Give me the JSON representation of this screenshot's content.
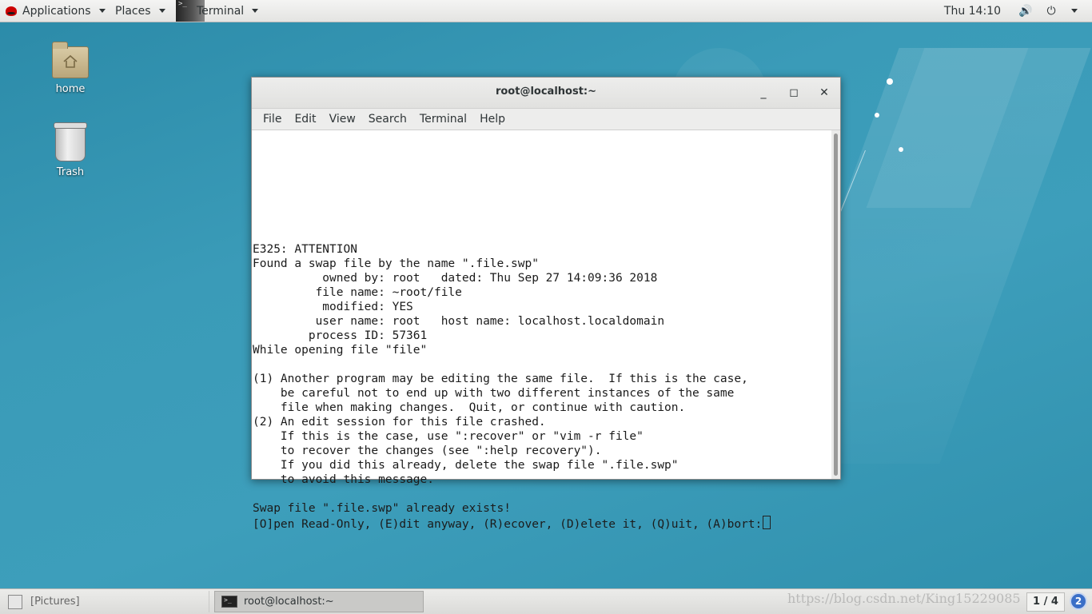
{
  "topbar": {
    "applications": "Applications",
    "places": "Places",
    "terminal_app": "Terminal",
    "clock": "Thu 14:10",
    "volume_icon": "volume-icon",
    "power_icon": "power-icon"
  },
  "desktop": {
    "icons": [
      {
        "label": "home",
        "icon": "folder-home-icon"
      },
      {
        "label": "Trash",
        "icon": "trash-icon"
      }
    ]
  },
  "window": {
    "title": "root@localhost:~",
    "menu": [
      "File",
      "Edit",
      "View",
      "Search",
      "Terminal",
      "Help"
    ],
    "terminal_lines": [
      "E325: ATTENTION",
      "Found a swap file by the name \".file.swp\"",
      "          owned by: root   dated: Thu Sep 27 14:09:36 2018",
      "         file name: ~root/file",
      "          modified: YES",
      "         user name: root   host name: localhost.localdomain",
      "        process ID: 57361",
      "While opening file \"file\"",
      "",
      "(1) Another program may be editing the same file.  If this is the case,",
      "    be careful not to end up with two different instances of the same",
      "    file when making changes.  Quit, or continue with caution.",
      "(2) An edit session for this file crashed.",
      "    If this is the case, use \":recover\" or \"vim -r file\"",
      "    to recover the changes (see \":help recovery\").",
      "    If you did this already, delete the swap file \".file.swp\"",
      "    to avoid this message.",
      "",
      "Swap file \".file.swp\" already exists!"
    ],
    "prompt_line": "[O]pen Read-Only, (E)dit anyway, (R)ecover, (D)elete it, (Q)uit, (A)bort:"
  },
  "taskbar": {
    "pictures": "[Pictures]",
    "terminal_task": "root@localhost:~",
    "watermark": "https://blog.csdn.net/King15229085",
    "workspace": "1 / 4",
    "notifications": "2"
  },
  "colors": {
    "wallpaper": "#3a9bb8",
    "panel": "#e8e8e7",
    "terminal_bg": "#ffffff"
  }
}
